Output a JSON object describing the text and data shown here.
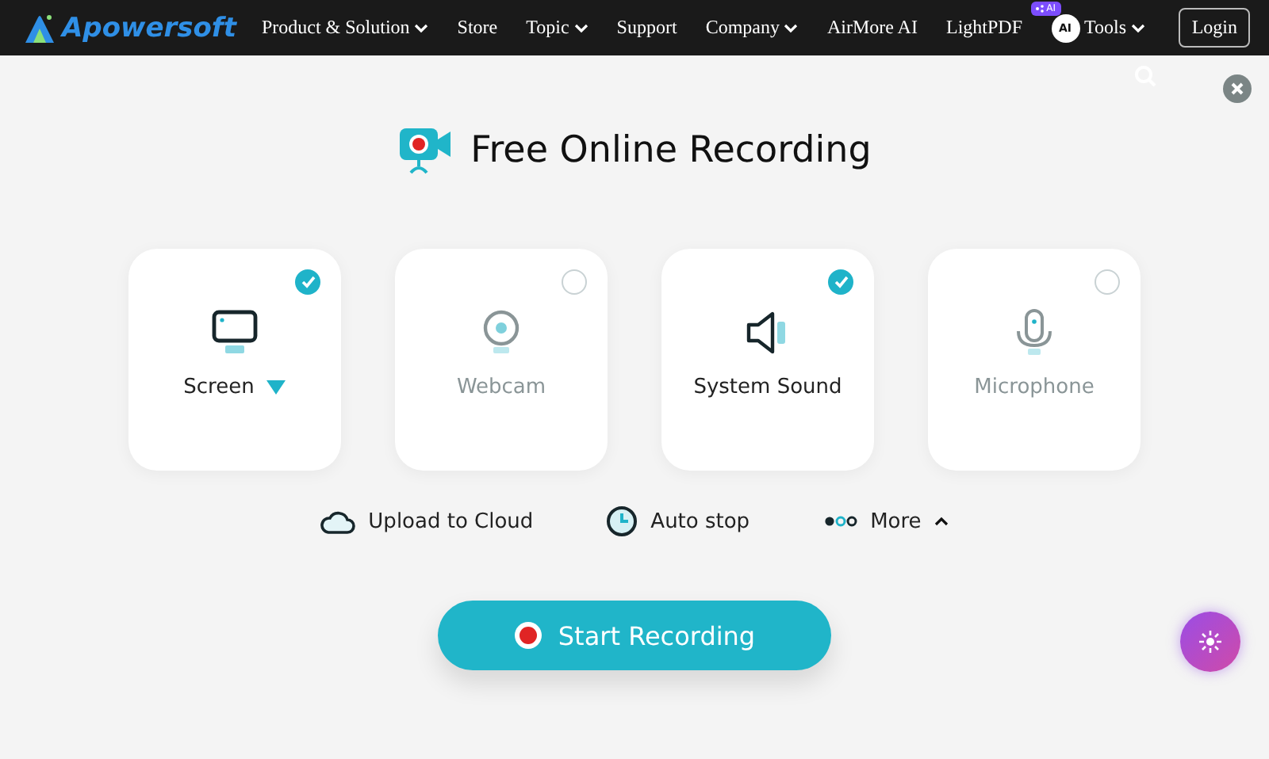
{
  "nav": {
    "brand": "Apowersoft",
    "items": [
      {
        "label": "Product & Solution",
        "dropdown": true
      },
      {
        "label": "Store",
        "dropdown": false
      },
      {
        "label": "Topic",
        "dropdown": true
      },
      {
        "label": "Support",
        "dropdown": false
      },
      {
        "label": "Company",
        "dropdown": true
      },
      {
        "label": "AirMore AI",
        "dropdown": false
      },
      {
        "label": "LightPDF",
        "dropdown": false,
        "badge": "AI"
      },
      {
        "label": "Tools",
        "dropdown": true,
        "icon_badge": "AI"
      }
    ],
    "login": "Login"
  },
  "title": "Free Online Recording",
  "sources": [
    {
      "label": "Screen",
      "kind": "screen",
      "checked": true,
      "has_menu": true
    },
    {
      "label": "Webcam",
      "kind": "webcam",
      "checked": false,
      "has_menu": false
    },
    {
      "label": "System Sound",
      "kind": "sound",
      "checked": true,
      "has_menu": false
    },
    {
      "label": "Microphone",
      "kind": "mic",
      "checked": false,
      "has_menu": false
    }
  ],
  "options": [
    {
      "label": "Upload to Cloud",
      "kind": "cloud"
    },
    {
      "label": "Auto stop",
      "kind": "clock"
    },
    {
      "label": "More",
      "kind": "more"
    }
  ],
  "start_button": "Start Recording"
}
